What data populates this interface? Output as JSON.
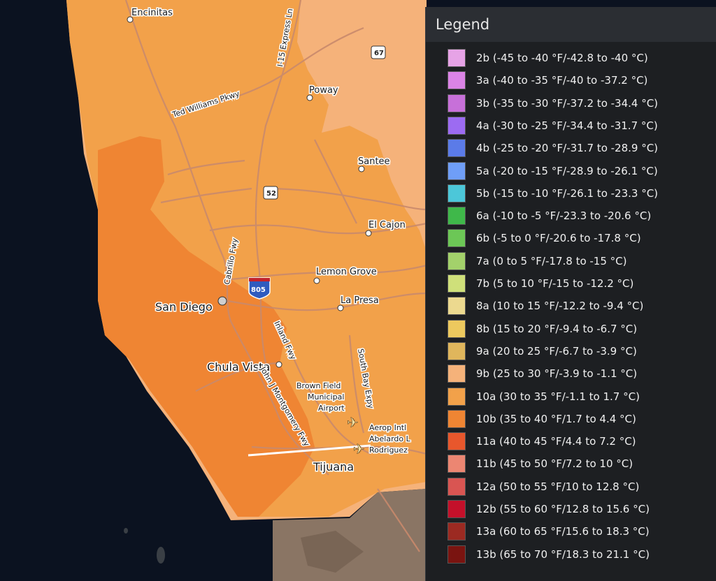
{
  "legend": {
    "title": "Legend",
    "items": [
      {
        "label": "2b (-45 to -40 °F/-42.8 to -40 °C)",
        "color": "#e6a3e6"
      },
      {
        "label": "3a (-40 to -35 °F/-40 to -37.2 °C)",
        "color": "#db84e6"
      },
      {
        "label": "3b (-35 to -30 °F/-37.2 to -34.4 °C)",
        "color": "#c770d9"
      },
      {
        "label": "4a (-30 to -25 °F/-34.4 to -31.7 °C)",
        "color": "#9c6bf2"
      },
      {
        "label": "4b (-25 to -20 °F/-31.7 to -28.9 °C)",
        "color": "#5b7be8"
      },
      {
        "label": "5a (-20 to -15 °F/-28.9 to -26.1 °C)",
        "color": "#6f9ef7"
      },
      {
        "label": "5b (-15 to -10 °F/-26.1 to -23.3 °C)",
        "color": "#4cc7d9"
      },
      {
        "label": "6a (-10 to -5 °F/-23.3 to -20.6 °C)",
        "color": "#3fb84a"
      },
      {
        "label": "6b (-5 to 0 °F/-20.6 to -17.8 °C)",
        "color": "#6cc756"
      },
      {
        "label": "7a (0 to 5 °F/-17.8 to -15 °C)",
        "color": "#a3d16b"
      },
      {
        "label": "7b (5 to 10 °F/-15 to -12.2 °C)",
        "color": "#cfe07a"
      },
      {
        "label": "8a (10 to 15 °F/-12.2 to -9.4 °C)",
        "color": "#ecd98f"
      },
      {
        "label": "8b (15 to 20 °F/-9.4 to -6.7 °C)",
        "color": "#edc95e"
      },
      {
        "label": "9a (20 to 25 °F/-6.7 to -3.9 °C)",
        "color": "#e0b65c"
      },
      {
        "label": "9b (25 to 30 °F/-3.9 to -1.1 °C)",
        "color": "#f5b27a"
      },
      {
        "label": "10a (30 to 35 °F/-1.1 to 1.7 °C)",
        "color": "#f2a14a"
      },
      {
        "label": "10b (35 to 40 °F/1.7 to 4.4 °C)",
        "color": "#ef8533"
      },
      {
        "label": "11a (40 to 45 °F/4.4 to 7.2 °C)",
        "color": "#e8572c"
      },
      {
        "label": "11b (45 to 50 °F/7.2 to 10 °C)",
        "color": "#ec8672"
      },
      {
        "label": "12a (50 to 55 °F/10 to 12.8 °C)",
        "color": "#d95552"
      },
      {
        "label": "12b (55 to 60 °F/12.8 to 15.6 °C)",
        "color": "#c4102a"
      },
      {
        "label": "13a (60 to 65 °F/15.6 to 18.3 °C)",
        "color": "#9c2a22"
      },
      {
        "label": "13b (65 to 70 °F/18.3 to 21.1 °C)",
        "color": "#7a1410"
      }
    ]
  },
  "map": {
    "colors": {
      "ocean": "#0b1220",
      "zone_9b": "#f5b27a",
      "zone_10a": "#f2a14a",
      "zone_10b": "#ef8533",
      "mexico": "#8a7564",
      "road": "#c98a6c"
    },
    "places": {
      "encinitas": "Encinitas",
      "poway": "Poway",
      "santee": "Santee",
      "el_cajon": "El Cajon",
      "lemon_grove": "Lemon Grove",
      "la_presa": "La Presa",
      "san_diego": "San Diego",
      "chula_vista": "Chula Vista",
      "brown_field_1": "Brown Field",
      "brown_field_2": "Municipal",
      "brown_field_3": "Airport",
      "aerop_1": "Aerop Intl",
      "aerop_2": "Abelardo L",
      "aerop_3": "Rodriguez",
      "tijuana": "Tijuana"
    },
    "roads": {
      "i15": "I-15 Express Ln",
      "ted_williams": "Ted Williams Pkwy",
      "cabrillo": "Cabrillo Fwy",
      "inland": "Inland Fwy",
      "montgomery": "John J Montgomery Fwy",
      "south_bay": "South Bay Expy"
    },
    "shields": {
      "sr67": "67",
      "sr52": "52",
      "i805": "805"
    }
  }
}
